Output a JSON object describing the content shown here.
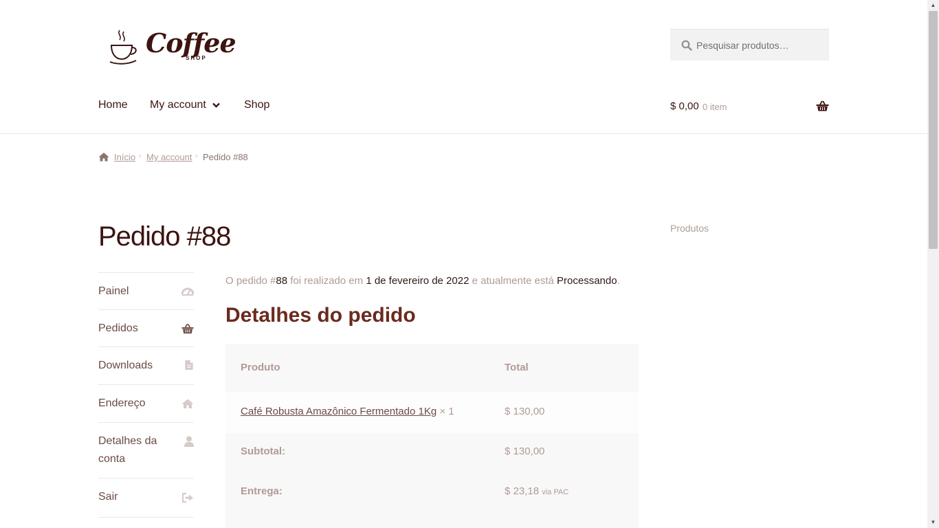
{
  "header": {
    "logo": {
      "script": "Coffee",
      "sub": "SHOP"
    },
    "search": {
      "placeholder": "Pesquisar produtos…",
      "icon": "search-icon"
    },
    "nav": {
      "home": "Home",
      "my_account": "My account",
      "shop": "Shop"
    },
    "cart": {
      "amount": "$ 0,00",
      "count": "0 item",
      "icon": "basket-icon"
    }
  },
  "breadcrumb": {
    "home": "Início",
    "account": "My account",
    "current": "Pedido #88"
  },
  "page": {
    "title": "Pedido #88"
  },
  "account_nav": {
    "items": [
      {
        "label": "Painel",
        "icon": "dashboard-icon"
      },
      {
        "label": "Pedidos",
        "icon": "basket-icon"
      },
      {
        "label": "Downloads",
        "icon": "file-icon"
      },
      {
        "label": "Endereço",
        "icon": "home-icon"
      },
      {
        "label": "Detalhes da conta",
        "icon": "user-icon"
      },
      {
        "label": "Sair",
        "icon": "sign-out-icon"
      }
    ]
  },
  "order": {
    "notice": {
      "p1": "O pedido #",
      "number": "88",
      "p2": " foi realizado em ",
      "date": "1 de fevereiro de 2022",
      "p3": " e atualmente está ",
      "status": "Processando",
      "p4": "."
    },
    "section_title": "Detalhes do pedido",
    "table": {
      "header": {
        "product": "Produto",
        "total": "Total"
      },
      "item": {
        "name": "Café Robusta Amazônico Fermentado 1Kg",
        "qty": "× 1",
        "total": "$ 130,00"
      },
      "subtotal": {
        "label": "Subtotal:",
        "value": "$ 130,00"
      },
      "shipping": {
        "label": "Entrega:",
        "value": "$ 23,18",
        "method": "via PAC"
      }
    }
  },
  "widget": {
    "title": "Produtos"
  },
  "colors": {
    "brand_dark": "#3c1410",
    "heading": "#6b2a1e",
    "muted": "#b19a96",
    "table_bg": "#f8f8f8"
  }
}
